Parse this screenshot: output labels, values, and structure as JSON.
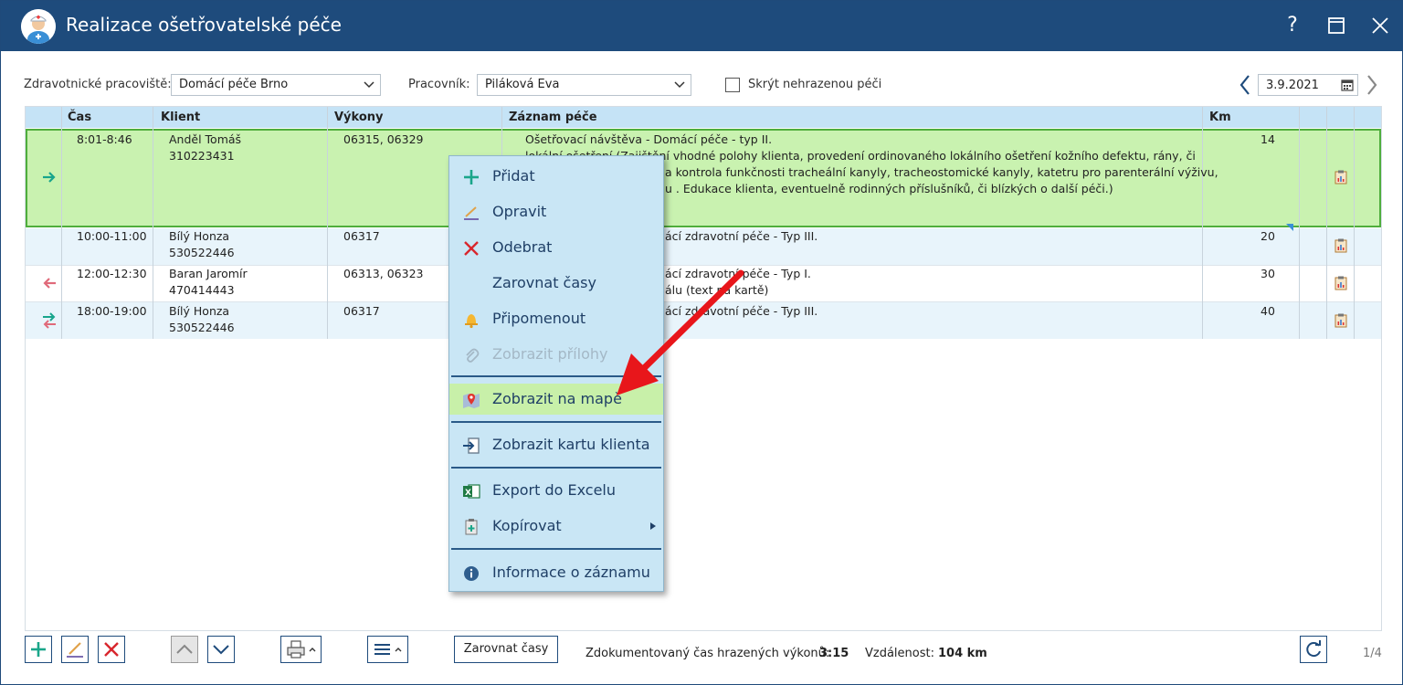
{
  "window": {
    "title": "Realizace ošetřovatelské péče",
    "help": "?",
    "maximize": "☐",
    "close": "✕"
  },
  "filters": {
    "workplace_label": "Zdravotnické pracoviště:",
    "workplace_value": "Domácí péče Brno",
    "worker_label": "Pracovník:",
    "worker_value": "Piláková Eva",
    "hide_unpaid_label": "Skrýt nehrazenou péči",
    "hide_unpaid_checked": false,
    "date": "3.9.2021"
  },
  "grid": {
    "columns": [
      "Čas",
      "Klient",
      "Výkony",
      "Záznam péče",
      "Km"
    ],
    "rows": [
      {
        "time": "8:01-8:46",
        "client_name": "Anděl Tomáš",
        "client_id": "310223431",
        "procedures": "06315, 06329",
        "record_line1": "Ošetřovací návštěva - Domácí péče - typ II.",
        "record_line2": "lokální ošetření (Zajištění vhodné polohy klienta, provedení ordinovaného lokálního ošetření kožního defektu, rány, či",
        "record_line3": "a kontrola funkčnosti tracheální kanyly, tracheostomické kanyly, katetru pro parenterální výživu,",
        "record_line4": "u . Edukace klienta, eventuelně rodinných příslušníků, či blízkých o další péči.)",
        "km": "14",
        "direction": "right"
      },
      {
        "time": "10:00-11:00",
        "client_name": "Bílý Honza",
        "client_id": "530522446",
        "procedures": "06317",
        "record_line1": "ácí zdravotní péče - Typ III.",
        "record_line2": "",
        "km": "20",
        "direction": ""
      },
      {
        "time": "12:00-12:30",
        "client_name": "Baran Jaromír",
        "client_id": "470414443",
        "procedures": "06313, 06323",
        "record_line1": "ácí zdravotní péče - Typ I.",
        "record_line2": "álu (text na kartě)",
        "km": "30",
        "direction": "left"
      },
      {
        "time": "18:00-19:00",
        "client_name": "Bílý Honza",
        "client_id": "530522446",
        "procedures": "06317",
        "record_line1": "ácí zdravotní péče - Typ III.",
        "record_line2": "",
        "km": "40",
        "direction": "both"
      }
    ]
  },
  "context_menu": {
    "items": [
      {
        "label": "Přidat",
        "icon": "plus-icon"
      },
      {
        "label": "Opravit",
        "icon": "pencil-icon"
      },
      {
        "label": "Odebrat",
        "icon": "x-icon"
      },
      {
        "label": "Zarovnat časy",
        "icon": ""
      },
      {
        "label": "Připomenout",
        "icon": "bell-icon"
      },
      {
        "label": "Zobrazit přílohy",
        "icon": "paperclip-icon",
        "disabled": true
      },
      {
        "label": "Zobrazit na mapě",
        "icon": "map-pin-icon",
        "highlighted": true
      },
      {
        "label": "Zobrazit kartu klienta",
        "icon": "card-icon"
      },
      {
        "label": "Export do Excelu",
        "icon": "excel-icon"
      },
      {
        "label": "Kopírovat",
        "icon": "copy-icon",
        "submenu": true
      },
      {
        "label": "Informace o záznamu",
        "icon": "info-icon"
      }
    ]
  },
  "toolbar": {
    "align_times": "Zarovnat časy",
    "documented_label": "Zdokumentovaný čas hrazených výkonů:",
    "documented_value": "3:15",
    "distance_label": "Vzdálenost:",
    "distance_value": "104 km",
    "page": "1/4"
  },
  "colors": {
    "titlebar": "#1e4b7c",
    "header": "#c5e3f6",
    "selected_row": "#c9f2b0",
    "menu": "#c9e6f5",
    "arrow": "#e8161b"
  }
}
